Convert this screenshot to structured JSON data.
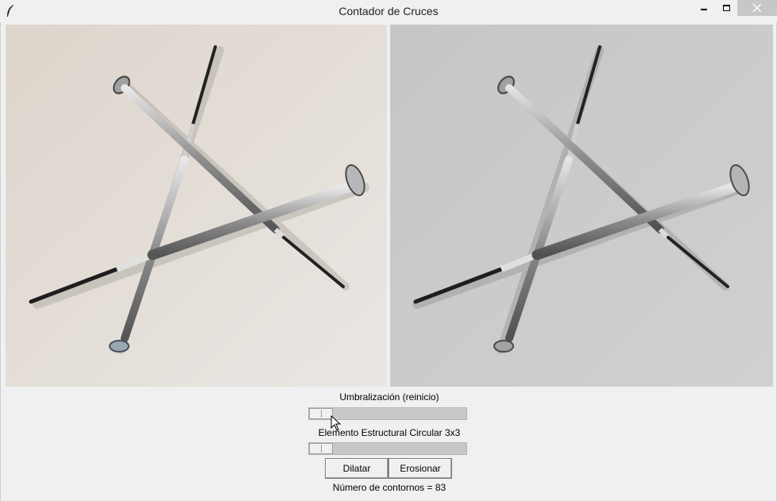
{
  "window": {
    "title": "Contador de Cruces"
  },
  "icons": {
    "app": "feather-icon",
    "minimize": "minimize-icon",
    "maximize": "maximize-icon",
    "close": "close-icon"
  },
  "images": {
    "left": "color-photo",
    "right": "grayscale-photo"
  },
  "controls": {
    "threshold_label": "Umbralización (reinicio)",
    "threshold_value": 0,
    "struct_label": "Elemento Estructural Circular 3x3",
    "struct_value": 0,
    "dilate_label": "Dilatar",
    "erode_label": "Erosionar",
    "contour_count": "Número de contornos = 83"
  },
  "colors": {
    "window_bg": "#f0f0f0",
    "left_bg": "#e4ded8",
    "right_bg": "#c9c9c9"
  }
}
